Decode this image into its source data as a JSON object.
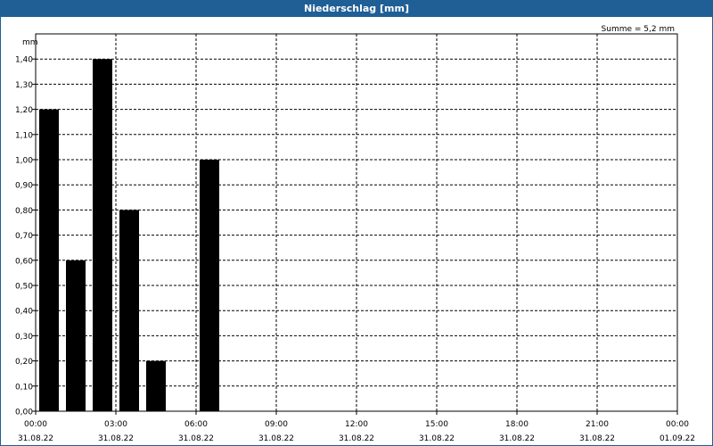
{
  "window": {
    "title": "Niederschlag [mm]"
  },
  "chart_data": {
    "type": "bar",
    "title": "Niederschlag [mm]",
    "ylabel": "mm",
    "annotation": "Summe = 5,2 mm",
    "ylim": [
      0,
      1.5
    ],
    "y_ticks": [
      "0,00",
      "0,10",
      "0,20",
      "0,30",
      "0,40",
      "0,50",
      "0,60",
      "0,70",
      "0,80",
      "0,90",
      "1,00",
      "1,10",
      "1,20",
      "1,30",
      "1,40"
    ],
    "x_range_hours": [
      0,
      24
    ],
    "x_ticks": [
      {
        "time": "00:00",
        "date": "31.08.22"
      },
      {
        "time": "03:00",
        "date": "31.08.22"
      },
      {
        "time": "06:00",
        "date": "31.08.22"
      },
      {
        "time": "09:00",
        "date": "31.08.22"
      },
      {
        "time": "12:00",
        "date": "31.08.22"
      },
      {
        "time": "15:00",
        "date": "31.08.22"
      },
      {
        "time": "18:00",
        "date": "31.08.22"
      },
      {
        "time": "21:00",
        "date": "31.08.22"
      },
      {
        "time": "00:00",
        "date": "01.09.22"
      }
    ],
    "bars": [
      {
        "x": "31.08.22 00:00",
        "value": 1.2
      },
      {
        "x": "31.08.22 01:00",
        "value": 0.6
      },
      {
        "x": "31.08.22 02:00",
        "value": 1.4
      },
      {
        "x": "31.08.22 03:00",
        "value": 0.8
      },
      {
        "x": "31.08.22 04:00",
        "value": 0.2
      },
      {
        "x": "31.08.22 06:00",
        "value": 1.0
      }
    ],
    "grid": true
  }
}
